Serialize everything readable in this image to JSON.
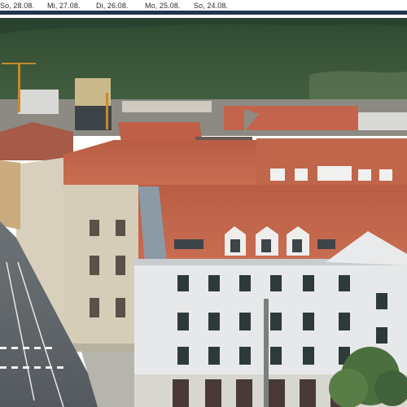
{
  "date_tabs": [
    {
      "label": "So, 28.08."
    },
    {
      "label": "Mi, 27.08."
    },
    {
      "label": "Di, 26.08."
    },
    {
      "label": "Mo, 25.08."
    },
    {
      "label": "So, 24.08."
    }
  ],
  "image": {
    "subject": "webcam"
  },
  "colors": {
    "bar": "#1f3552",
    "roof": "#c0654a",
    "facade": "#e4e6e7",
    "hill": "#3e5a3c"
  }
}
